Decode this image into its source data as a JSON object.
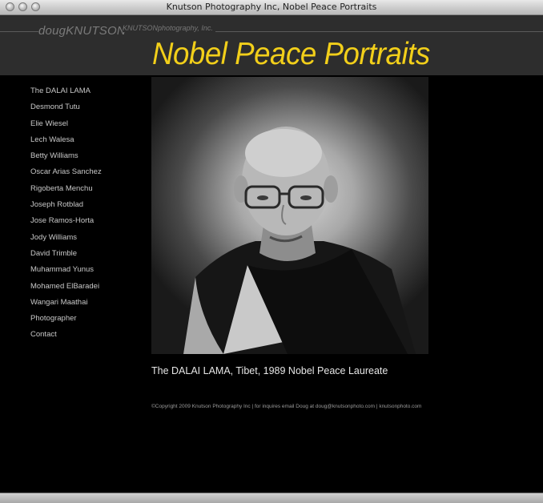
{
  "window": {
    "title": "Knutson Photography Inc, Nobel Peace Portraits"
  },
  "header": {
    "brand_name": "dougKNUTSON",
    "brand_sub": "KNUTSONphotography, Inc.",
    "site_title": "Nobel Peace Portraits",
    "accent_color": "#f2cf1a"
  },
  "nav": {
    "items": [
      "The DALAI LAMA",
      "Desmond Tutu",
      "Elie Wiesel",
      "Lech Walesa",
      "Betty Williams",
      "Oscar Arias Sanchez",
      "Rigoberta Menchu",
      "Joseph Rotblad",
      "Jose Ramos-Horta",
      "Jody Williams",
      "David Trimble",
      "Muhammad Yunus",
      "Mohamed ElBaradei",
      "Wangari Maathai",
      "Photographer",
      "Contact"
    ]
  },
  "main": {
    "caption": "The DALAI LAMA, Tibet, 1989 Nobel Peace Laureate",
    "footer": "©Copyright 2009 Knutson Photography Inc | for inquires email Doug at doug@knutsonphoto.com | knutsonphoto.com"
  }
}
